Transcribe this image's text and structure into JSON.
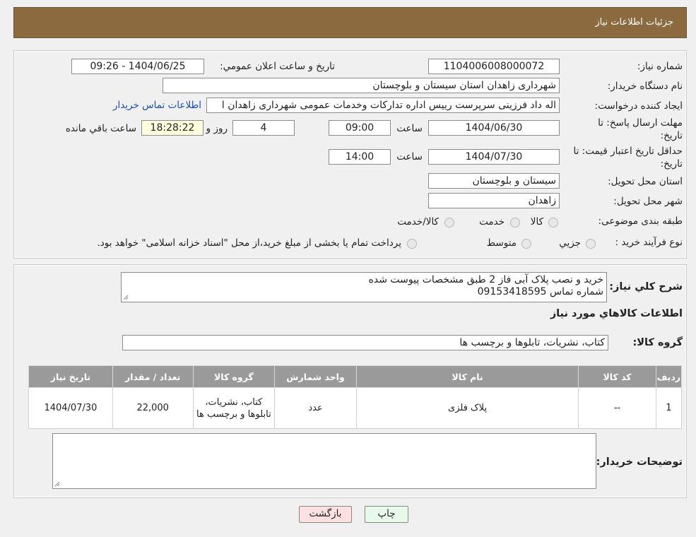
{
  "header": {
    "title": "جزئیات اطلاعات نیاز"
  },
  "form": {
    "need_number_label": "شماره نیاز:",
    "need_number": "1104006008000072",
    "announce_label": "تاریخ و ساعت اعلان عمومي:",
    "announce_value": "1404/06/25 - 09:26",
    "buyer_org_label": "نام دستگاه خريدار:",
    "buyer_org": "شهرداری زاهدان استان سیستان و بلوچستان",
    "creator_label": "ايجاد کننده درخواست:",
    "creator": "اله داد فرزینی سرپرست رییس اداره تدارکات وخدمات عمومی شهرداری زاهدان ا",
    "contact_link": "اطلاعات تماس خريدار",
    "deadline_label_1": "مهلت ارسال پاسخ: تا",
    "deadline_label_2": "تاريخ:",
    "deadline_date": "1404/06/30",
    "time_label": "ساعت",
    "deadline_time": "09:00",
    "days_value": "4",
    "days_label": "روز و",
    "remaining_time": "18:28:22",
    "remaining_label": "ساعت باقي مانده",
    "price_valid_label_1": "حداقل تاريخ اعتبار قيمت: تا",
    "price_valid_label_2": "تاريخ:",
    "price_valid_date": "1404/07/30",
    "price_valid_time": "14:00",
    "province_label": "استان محل تحويل:",
    "province": "سيستان و بلوچستان",
    "city_label": "شهر محل تحويل:",
    "city": "زاهدان",
    "category_label": "طبقه بندی موضوعی:",
    "category_options": [
      "کالا",
      "خدمت",
      "کالا/خدمت"
    ],
    "process_label": "نوع فرآيند خريد :",
    "process_options": [
      "جزيي",
      "متوسط"
    ],
    "process_note": "پرداخت تمام يا بخشی از مبلغ خريد،از محل \"اسناد خزانه اسلامی\" خواهد بود."
  },
  "description": {
    "label": "شرح کلي نياز:",
    "text_line1": "خرید و نصب پلاک آبی فاز 2 طبق مشخصات پیوست شده",
    "text_line2": "شماره تماس 09153418595"
  },
  "goods": {
    "section_title": "اطلاعات کالاهاي مورد نياز",
    "group_label": "گروه کالا:",
    "group_value": "کتاب، نشریات، تابلوها و برچسب ها",
    "columns": [
      "رديف",
      "کد کالا",
      "نام کالا",
      "واحد شمارش",
      "گروه کالا",
      "تعداد / مقدار",
      "تاريخ نياز"
    ],
    "rows": [
      {
        "row": "1",
        "code": "--",
        "name": "پلاک فلزی",
        "unit": "عدد",
        "group": "کتاب، نشریات، تابلوها و برچسب ها",
        "qty": "22,000",
        "date": "1404/07/30"
      }
    ]
  },
  "buyer_notes": {
    "label": "توضيحات خريدار:"
  },
  "buttons": {
    "print": "چاپ",
    "back": "بازگشت"
  },
  "colors": {
    "header_bg": "#8a6a3e",
    "back_button_bg": "#fde0e0",
    "print_button_bg": "#e9f9e9"
  }
}
